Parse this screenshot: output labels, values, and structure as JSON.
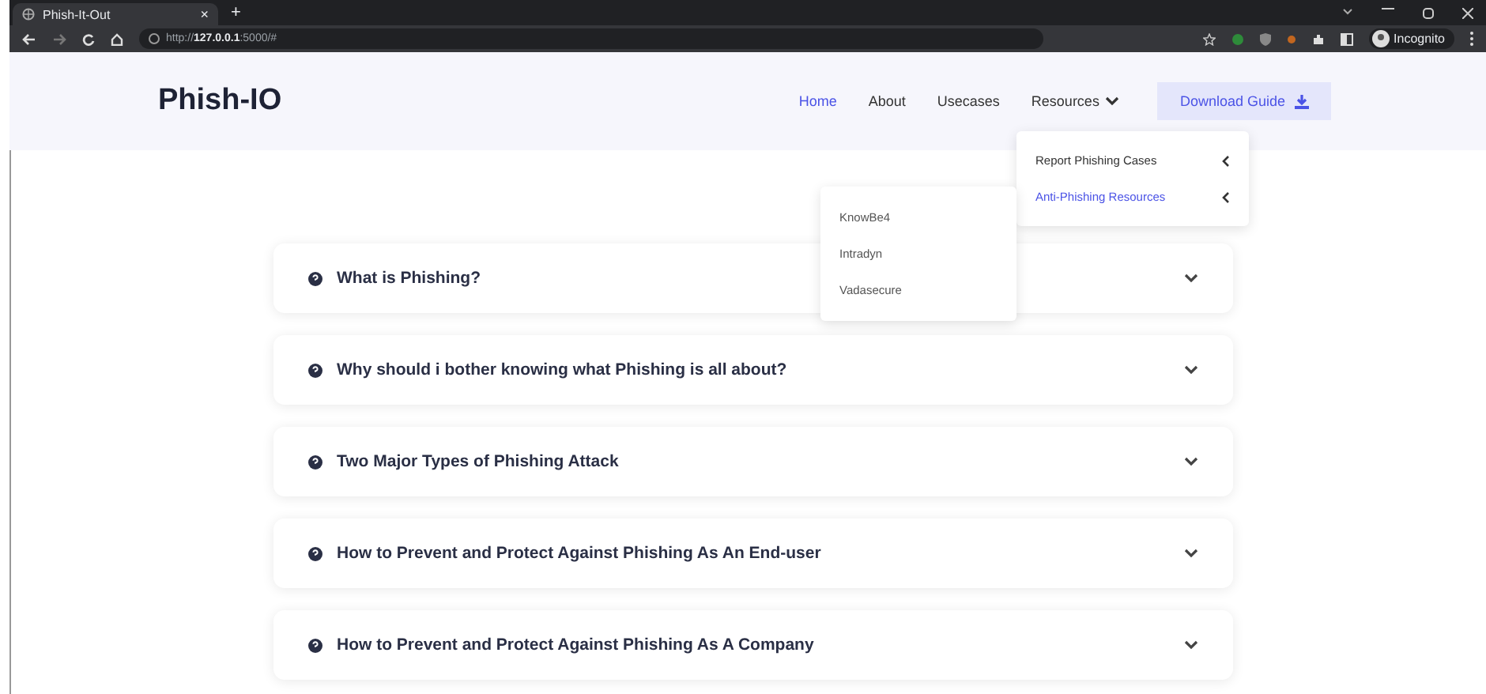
{
  "browser": {
    "tab_title": "Phish-It-Out",
    "new_tab": "+",
    "tab_close": "×",
    "url_scheme": "http://",
    "url_host": "127.0.0.1",
    "url_rest": ":5000/#",
    "profile": "Incognito"
  },
  "nav": {
    "logo": "Phish-IO",
    "links": [
      {
        "label": "Home",
        "selected": true
      },
      {
        "label": "About",
        "selected": false
      },
      {
        "label": "Usecases",
        "selected": false
      },
      {
        "label": "Resources",
        "selected": false
      }
    ],
    "button": "Download Guide"
  },
  "resources_menu": [
    {
      "label": "Report Phishing Cases",
      "selected": false
    },
    {
      "label": "Anti-Phishing Resources",
      "selected": true
    }
  ],
  "submenu": [
    "KnowBe4",
    "Intradyn",
    "Vadasecure"
  ],
  "faq": [
    {
      "question": "What is Phishing?",
      "expanded": false
    },
    {
      "question": "Why should i bother knowing what Phishing is all about?",
      "expanded": false
    },
    {
      "question": "Two Major Types of Phishing Attack",
      "expanded": false
    },
    {
      "question": "How to Prevent and Protect Against Phishing As An End-user",
      "expanded": false
    },
    {
      "question": "How to Prevent and Protect Against Phishing As A Company",
      "expanded": false
    }
  ]
}
